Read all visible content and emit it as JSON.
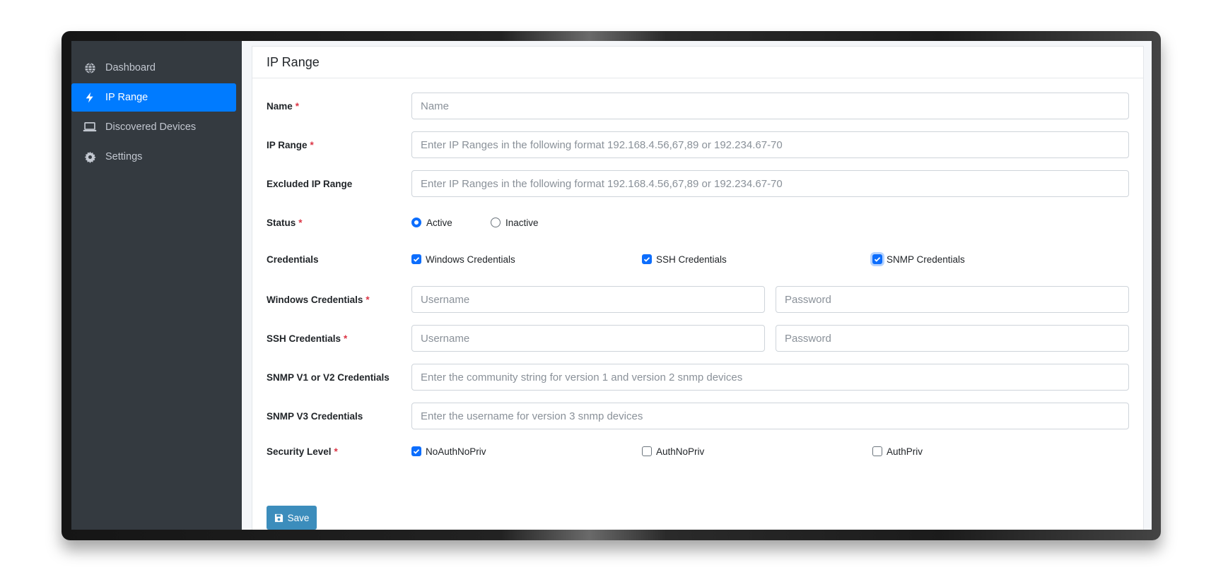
{
  "colors": {
    "sidebar_bg": "#343a40",
    "accent": "#007bff",
    "required": "#dc3545",
    "save_button": "#3c8dbc",
    "checkbox": "#0d6efd"
  },
  "sidebar": {
    "items": [
      {
        "label": "Dashboard",
        "icon": "globe-icon",
        "active": false
      },
      {
        "label": "IP Range",
        "icon": "bolt-icon",
        "active": true
      },
      {
        "label": "Discovered Devices",
        "icon": "laptop-icon",
        "active": false
      },
      {
        "label": "Settings",
        "icon": "gear-icon",
        "active": false
      }
    ]
  },
  "form": {
    "title": "IP Range",
    "required_mark": "*",
    "name": {
      "label": "Name",
      "placeholder": "Name"
    },
    "ip_range": {
      "label": "IP Range",
      "placeholder": "Enter IP Ranges in the following format 192.168.4.56,67,89 or 192.234.67-70"
    },
    "excluded_ip_range": {
      "label": "Excluded IP Range",
      "placeholder": "Enter IP Ranges in the following format 192.168.4.56,67,89 or 192.234.67-70"
    },
    "status": {
      "label": "Status",
      "options": [
        "Active",
        "Inactive"
      ],
      "selected": "Active"
    },
    "credentials": {
      "label": "Credentials",
      "options": [
        "Windows Credentials",
        "SSH Credentials",
        "SNMP Credentials"
      ],
      "checked": [
        true,
        true,
        true
      ]
    },
    "windows_credentials": {
      "label": "Windows Credentials",
      "username_placeholder": "Username",
      "password_placeholder": "Password"
    },
    "ssh_credentials": {
      "label": "SSH Credentials",
      "username_placeholder": "Username",
      "password_placeholder": "Password"
    },
    "snmp_v1_v2": {
      "label": "SNMP V1 or V2 Credentials",
      "placeholder": "Enter the community string for version 1 and version 2 snmp devices"
    },
    "snmp_v3": {
      "label": "SNMP V3 Credentials",
      "placeholder": "Enter the username for version 3 snmp devices"
    },
    "security_level": {
      "label": "Security Level",
      "options": [
        "NoAuthNoPriv",
        "AuthNoPriv",
        "AuthPriv"
      ],
      "checked": [
        true,
        false,
        false
      ]
    },
    "save_label": "Save"
  }
}
